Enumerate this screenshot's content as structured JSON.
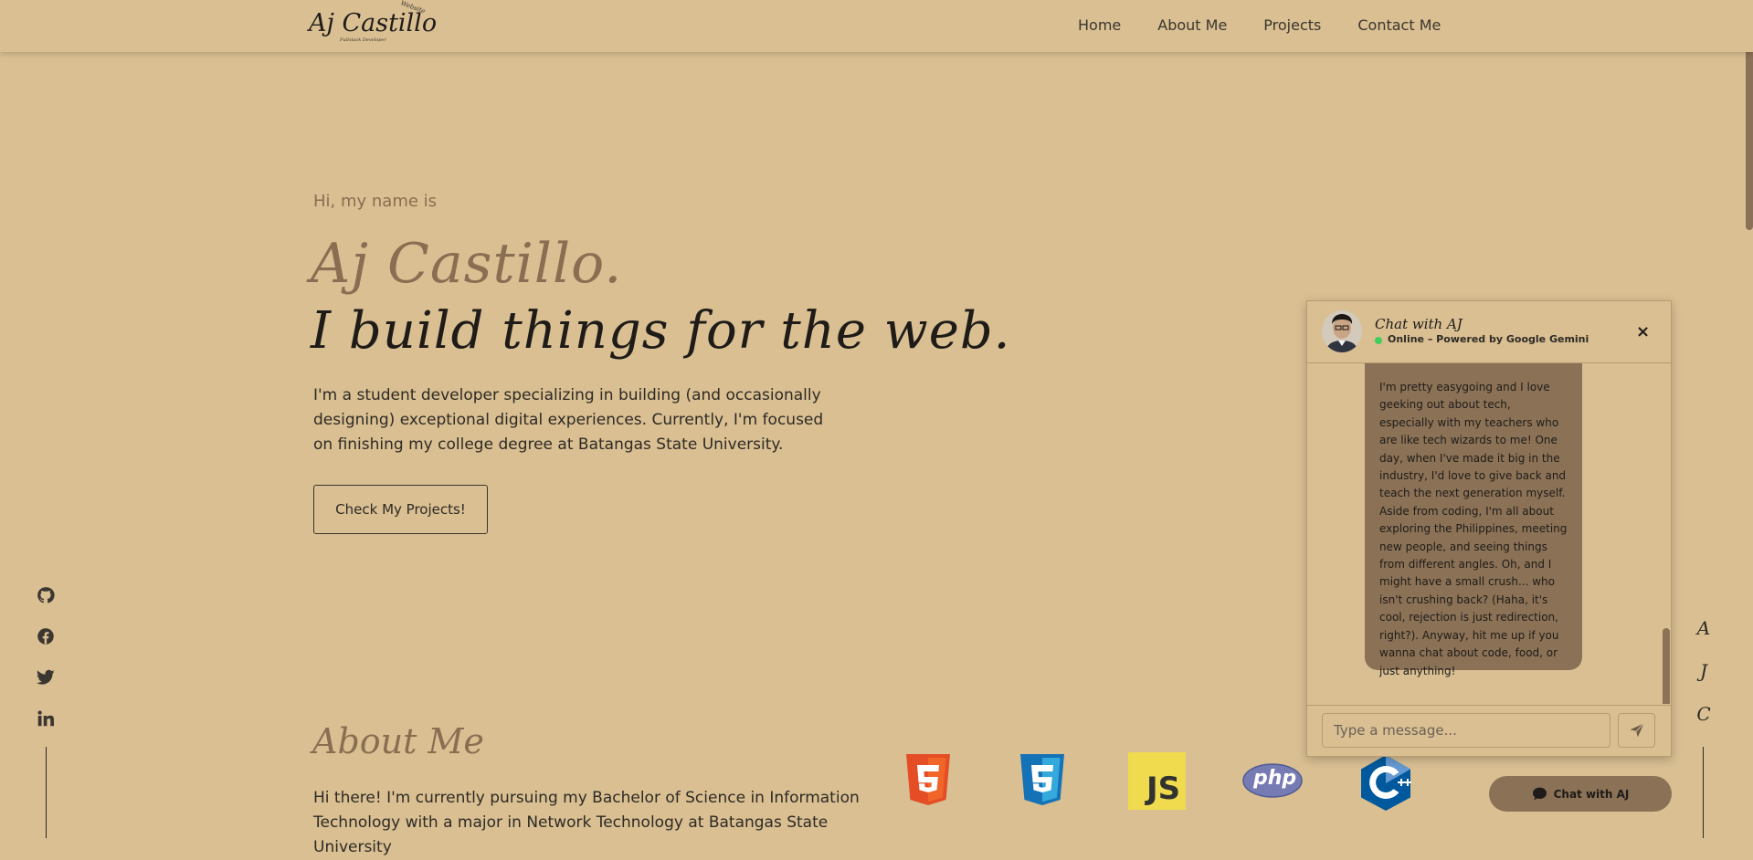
{
  "nav": {
    "logo_main": "Aj Castillo",
    "logo_sub": "Fullstack Developer",
    "logo_badge": "Website",
    "links": [
      "Home",
      "About Me",
      "Projects",
      "Contact Me"
    ]
  },
  "hero": {
    "greeting": "Hi, my name is",
    "name": "Aj Castillo.",
    "tagline": "I build things for the web.",
    "description": "I'm a student developer specializing in building (and occasionally designing) exceptional digital experiences. Currently, I'm focused on finishing my college degree at Batangas State University.",
    "cta_label": "Check My Projects!"
  },
  "socials": [
    "github-icon",
    "facebook-icon",
    "twitter-icon",
    "linkedin-icon"
  ],
  "side_letters": [
    "A",
    "J",
    "C"
  ],
  "about": {
    "heading": "About Me",
    "text": "Hi there! I'm currently pursuing my Bachelor of Science in Information Technology with a major in Network Technology at Batangas State University"
  },
  "tech_icons": [
    "HTML5",
    "CSS3",
    "JS",
    "php",
    "C++"
  ],
  "chat": {
    "title": "Chat with AJ",
    "status": "Online – Powered by Google Gemini",
    "close_label": "×",
    "message": "I'm pretty easygoing and I love geeking out about tech, especially with my teachers who are like tech wizards to me! One day, when I've made it big in the industry, I'd love to give back and teach the next generation myself. Aside from coding, I'm all about exploring the Philippines, meeting new people, and seeing things from different angles. Oh, and I might have a small crush... who isn't crushing back? (Haha, it's cool, rejection is just redirection, right?). Anyway, hit me up if you wanna chat about code, food, or just anything!",
    "input_placeholder": "Type a message...",
    "toggle_label": "Chat with AJ"
  },
  "colors": {
    "background": "#d9bf92",
    "accent": "#8b7256",
    "text": "#2e2a25",
    "online": "#3fcf5a"
  }
}
